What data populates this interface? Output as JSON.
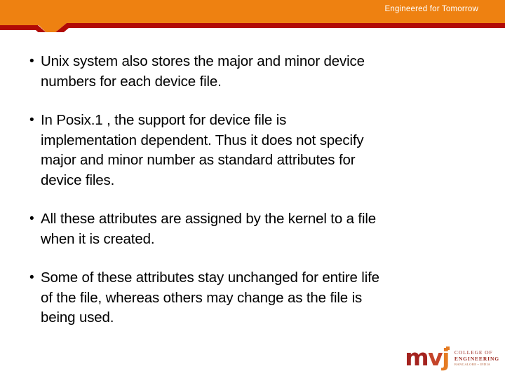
{
  "theme": {
    "banner_orange": "#ee8111",
    "banner_rule_red": "#b10a06",
    "text_color": "#000000",
    "page_background": "#ffffff",
    "logo_red": "#a4231f",
    "logo_orange": "#e57b23"
  },
  "header": {
    "tagline": "Engineered for Tomorrow"
  },
  "content": {
    "bullet_marker": "•",
    "bullets": [
      {
        "text": "Unix system also stores the major and minor device\nnumbers for each device file."
      },
      {
        "text": "In Posix.1 , the support for device file is\nimplementation dependent. Thus it does not specify\nmajor and minor number as standard attributes for\ndevice files."
      },
      {
        "text": "All these attributes are assigned by the kernel to a file\nwhen it is created."
      },
      {
        "text": "Some of these attributes stay unchanged for entire life\nof the file, whereas others may change as the file is\nbeing used."
      }
    ]
  },
  "logo": {
    "mark_m": "m",
    "mark_v": "v",
    "mark_j": "j",
    "line1": "COLLEGE OF",
    "line2": "ENGINEERING",
    "line3": "BANGALORE • INDIA"
  }
}
